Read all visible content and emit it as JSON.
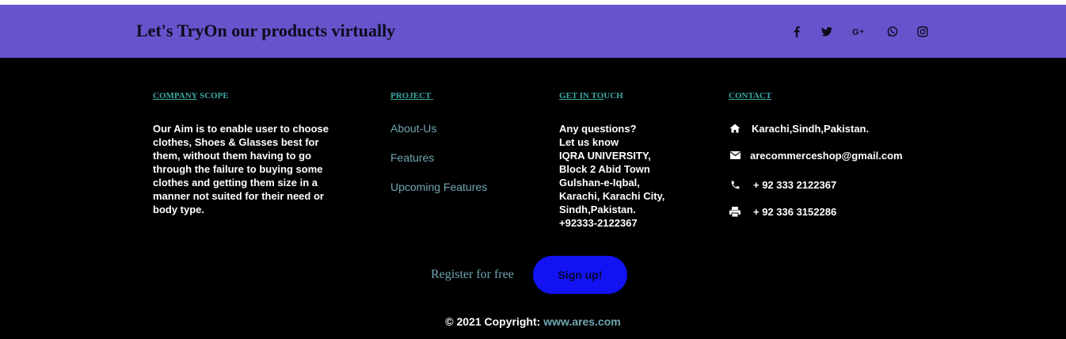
{
  "banner": {
    "title": "Let's TryOn our products virtually",
    "social": [
      "facebook-icon",
      "twitter-icon",
      "google-plus-icon",
      "whatsapp-icon",
      "instagram-icon"
    ]
  },
  "colors": {
    "banner_bg": "#6554cc",
    "footer_bg": "#000000",
    "heading_teal": "#39a7a1",
    "link_teal": "#6fa6b1",
    "signup_bg": "#1212f2"
  },
  "columns": {
    "company": {
      "title_underlined": "COMPANY",
      "title_rest": " SCOPE",
      "text": "Our Aim is to enable user to choose clothes, Shoes & Glasses best for them, without them having to go through the failure to buying some clothes and getting them size in a manner not suited for their need or body type."
    },
    "project": {
      "title": "PROJECT",
      "links": [
        "About-Us",
        "Features",
        "Upcoming Features"
      ]
    },
    "touch": {
      "title_underlined": "GET IN TO",
      "title_rest": "UCH",
      "lines": [
        "Any questions?",
        "Let us know",
        "IQRA UNIVERSITY,",
        "Block 2 Abid Town",
        "Gulshan-e-Iqbal,",
        "Karachi, Karachi City,",
        "Sindh,Pakistan.",
        "+92333-2122367"
      ]
    },
    "contact": {
      "title": "CONTACT",
      "items": [
        {
          "icon": "home-icon",
          "text": "Karachi,Sindh,Pakistan."
        },
        {
          "icon": "envelope-icon",
          "text": "arecommerceshop@gmail.com"
        },
        {
          "icon": "phone-icon",
          "text": "+ 92 333 2122367"
        },
        {
          "icon": "print-icon",
          "text": "+ 92 336 3152286"
        }
      ]
    }
  },
  "register": {
    "label": "Register for free",
    "button": "Sign up!"
  },
  "copyright": {
    "prefix": "© 2021 Copyright: ",
    "link": "www.ares.com"
  }
}
